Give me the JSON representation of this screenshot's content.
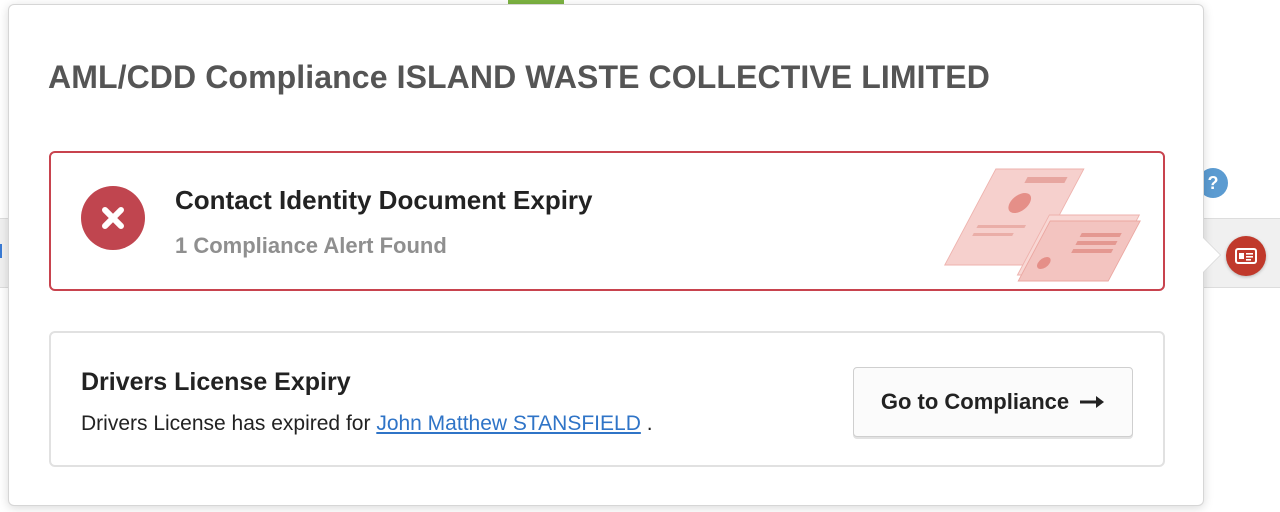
{
  "popover": {
    "title": "AML/CDD Compliance ISLAND WASTE COLLECTIVE LIMITED"
  },
  "alert": {
    "title": "Contact Identity Document Expiry",
    "subtitle": "1 Compliance Alert Found",
    "status_icon": "close-x-icon",
    "status_color": "#c0454f",
    "illustration": "id-documents-illustration"
  },
  "detail": {
    "title": "Drivers License Expiry",
    "text_prefix": "Drivers License has expired for",
    "person_link": "John Matthew STANSFIELD",
    "text_suffix": ".",
    "button_label": "Go to Compliance",
    "button_icon": "arrow-right-icon"
  },
  "background": {
    "help_icon_label": "?",
    "help_color": "#5b9bd1",
    "id_card_icon": "id-card-icon",
    "id_card_color": "#c0392b"
  }
}
